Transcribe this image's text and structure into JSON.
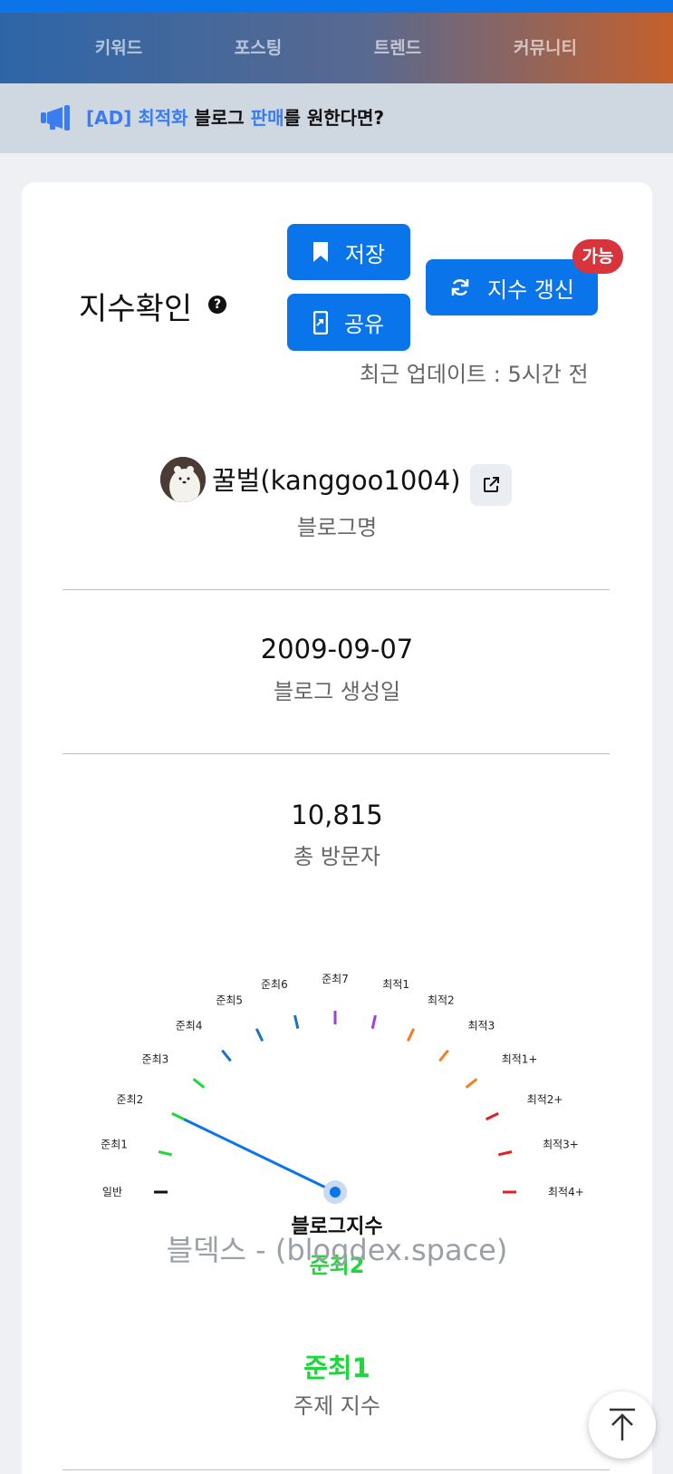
{
  "nav": {
    "items": [
      {
        "label": "키워드"
      },
      {
        "label": "포스팅"
      },
      {
        "label": "트렌드"
      },
      {
        "label": "커뮤니티"
      }
    ]
  },
  "ad": {
    "part1": "[AD] 최적화 ",
    "part2": "블로그 ",
    "part3": "판매",
    "part4": "를 원한다면?"
  },
  "header": {
    "title": "지수확인",
    "help_icon": "?",
    "save_label": "저장",
    "share_label": "공유",
    "refresh_label": "지수 갱신",
    "refresh_badge": "가능",
    "updated_text": "최근 업데이트 : 5시간 전"
  },
  "blog": {
    "name": "꿀벌(kanggoo1004)",
    "name_label": "블로그명",
    "created_date": "2009-09-07",
    "created_label": "블로그 생성일",
    "visitors": "10,815",
    "visitors_label": "총 방문자"
  },
  "gauge": {
    "title": "블로그지수",
    "value_label": "준최2",
    "levels": [
      "일반",
      "준최1",
      "준최2",
      "준최3",
      "준최4",
      "준최5",
      "준최6",
      "준최7",
      "최적1",
      "최적2",
      "최적3",
      "최적1+",
      "최적2+",
      "최적3+",
      "최적4+"
    ],
    "tick_colors": [
      "#111111",
      "#1ed83a",
      "#1ed83a",
      "#1ed83a",
      "#1a73c9",
      "#1a73c9",
      "#1a73c9",
      "#a040d8",
      "#a040d8",
      "#f08020",
      "#f08020",
      "#f08020",
      "#e02020",
      "#e02020",
      "#e02020"
    ],
    "current_index": 2,
    "needle_color": "#0a74ea",
    "accent_color": "#1ed83a"
  },
  "watermark": "블덱스 - (blogdex.space)",
  "topic": {
    "value": "준최1",
    "label": "주제 지수"
  },
  "icons": {
    "ad": "megaphone-icon",
    "save": "bookmark-icon",
    "share": "share-phone-icon",
    "refresh": "refresh-icon",
    "external": "external-link-icon",
    "scroll_top": "arrow-up-icon"
  }
}
